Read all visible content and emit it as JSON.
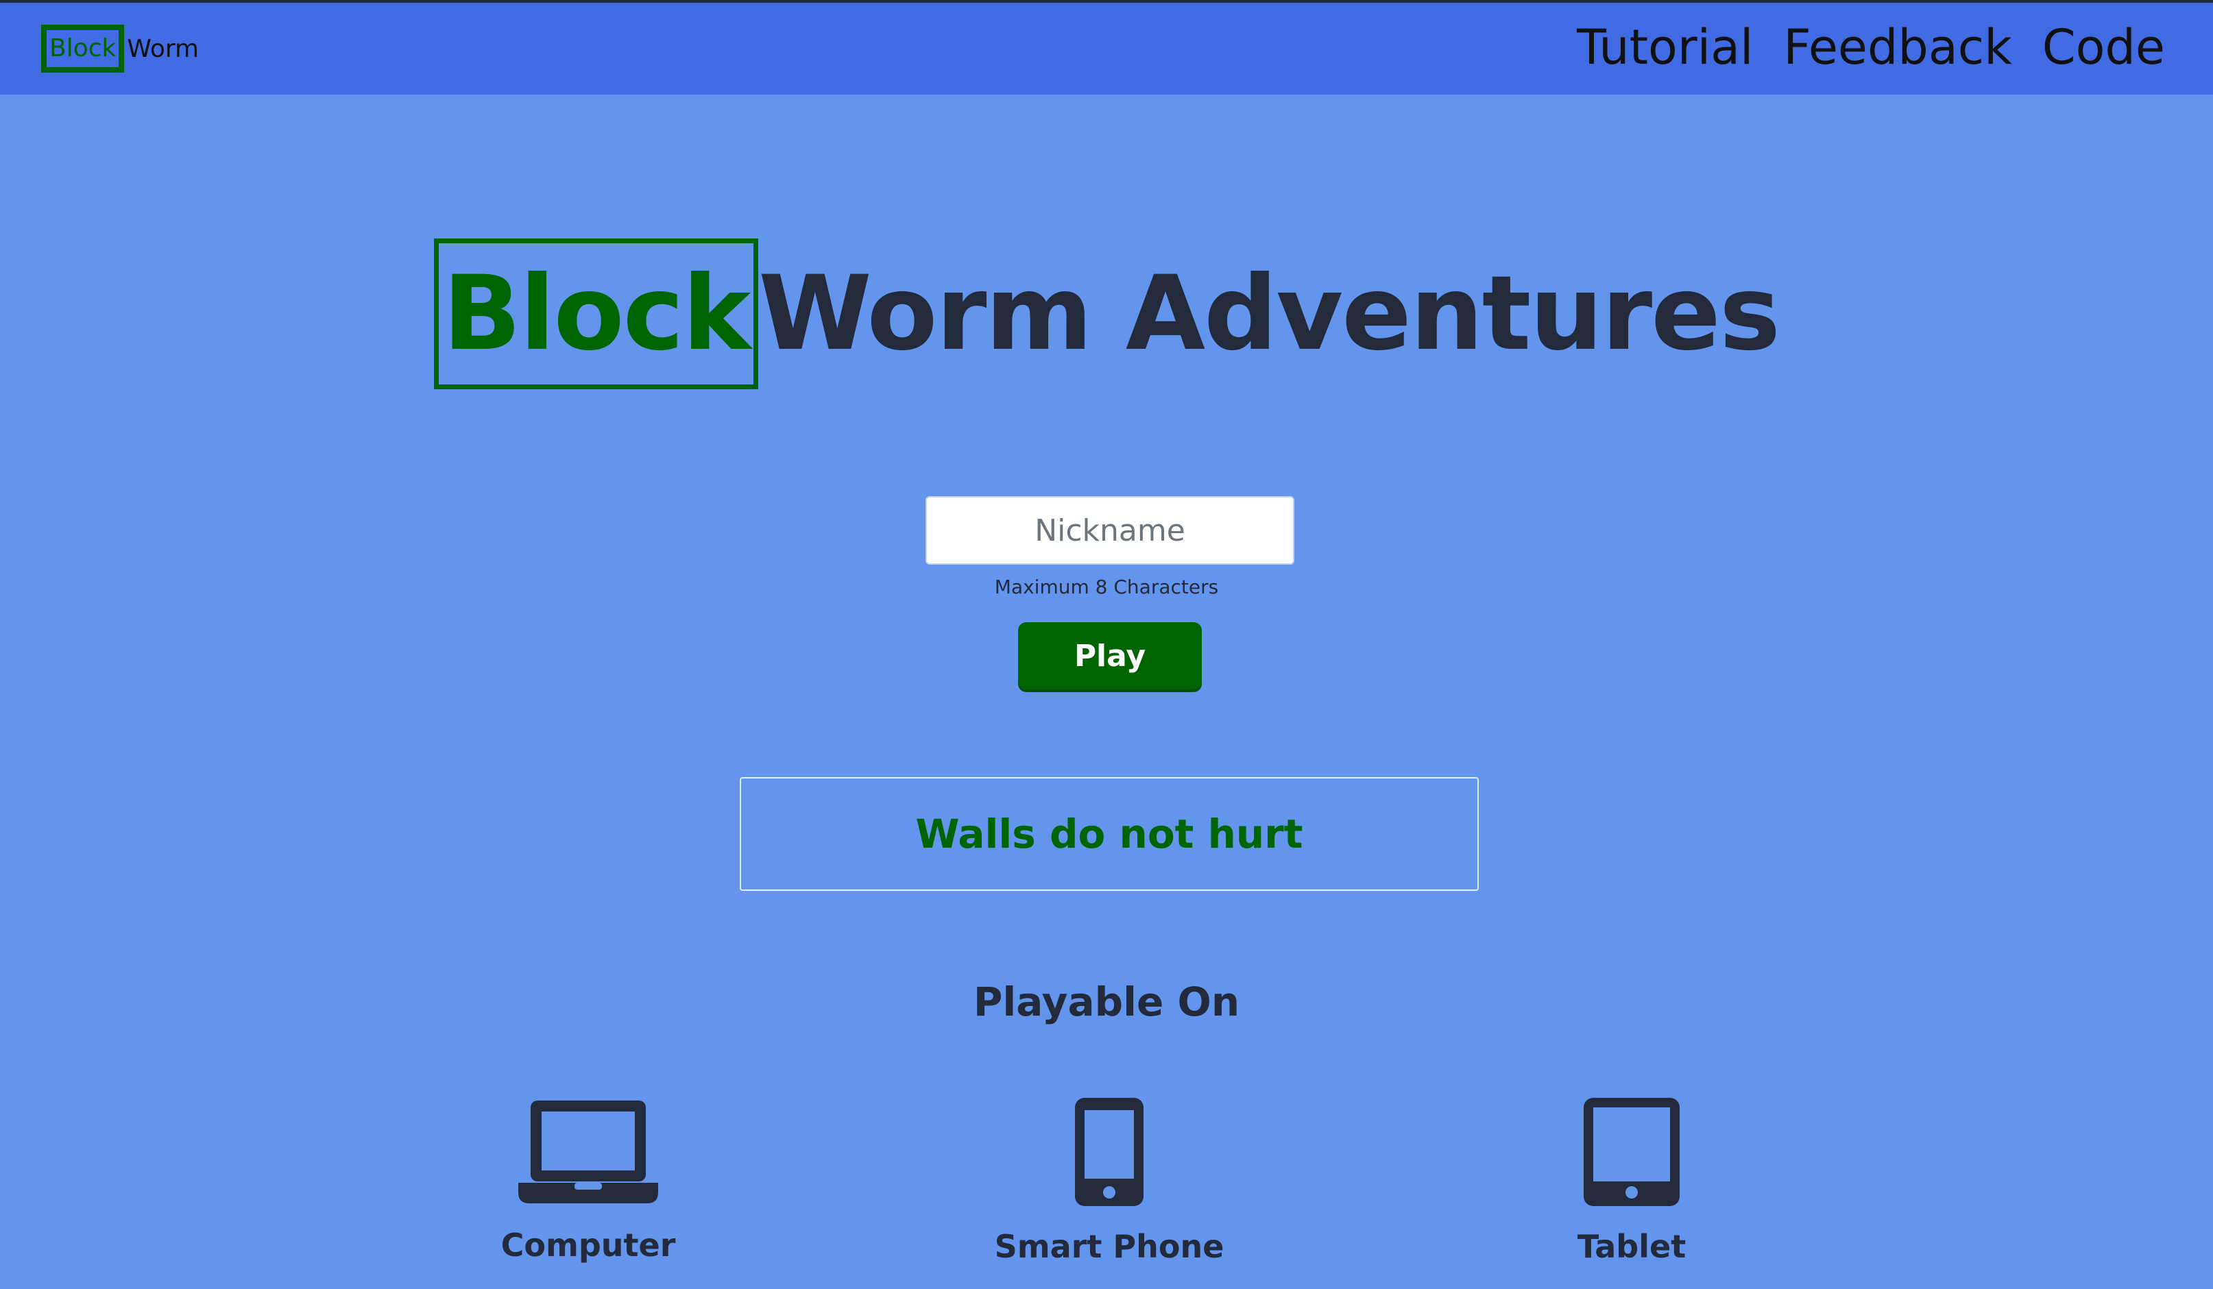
{
  "navbar": {
    "brand_block": "Block",
    "brand_worm": "Worm",
    "links": [
      "Tutorial",
      "Feedback",
      "Code"
    ]
  },
  "hero": {
    "title_block": "Block",
    "title_rest": "Worm Adventures"
  },
  "form": {
    "nickname_placeholder": "Nickname",
    "nickname_value": "",
    "hint": "Maximum 8 Characters",
    "play_label": "Play"
  },
  "tip": "Walls do not hurt",
  "playable": {
    "title": "Playable On",
    "devices": [
      {
        "label": "Computer",
        "icon": "laptop-icon"
      },
      {
        "label": "Smart Phone",
        "icon": "smartphone-icon"
      },
      {
        "label": "Tablet",
        "icon": "tablet-icon"
      }
    ]
  },
  "colors": {
    "page_bg": "#6495ec",
    "navbar_bg": "#416be3",
    "accent_green": "#006400",
    "text_dark": "#222a3c"
  }
}
